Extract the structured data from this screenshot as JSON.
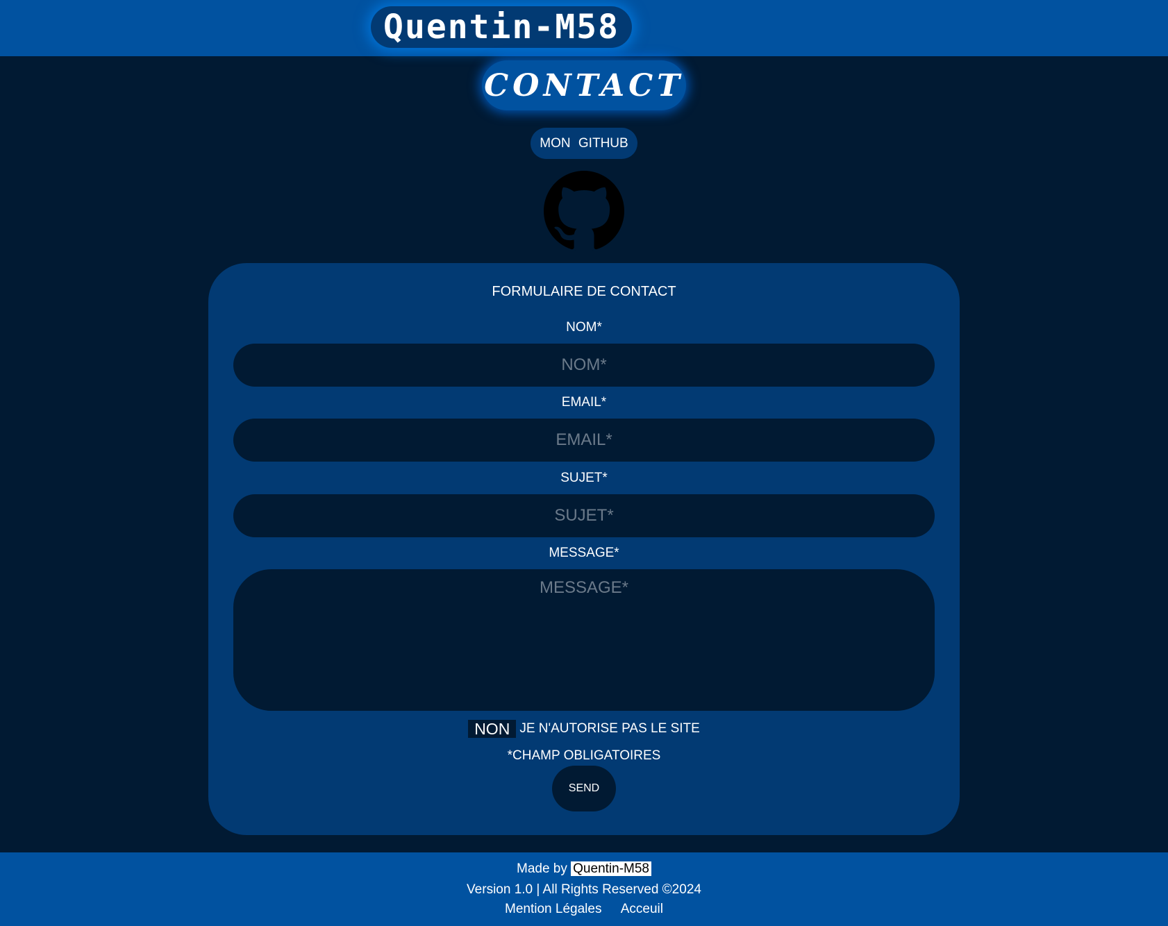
{
  "header": {
    "site_title": "Quentin-M58",
    "page_title": "CONTACT"
  },
  "github": {
    "label": "MON  GITHUB",
    "icon": "github-icon"
  },
  "form": {
    "heading": "FORMULAIRE DE CONTACT",
    "name_label": "NOM*",
    "name_placeholder": "NOM*",
    "name_value": "",
    "email_label": "EMAIL*",
    "email_placeholder": "EMAIL*",
    "email_value": "",
    "subject_label": "SUJET*",
    "subject_placeholder": "SUJET*",
    "subject_value": "",
    "message_label": "MESSAGE*",
    "message_placeholder": "MESSAGE*",
    "message_value": "",
    "consent_toggle": "NON",
    "consent_text": "JE N'AUTORISE PAS LE SITE",
    "required_note": "*CHAMP OBLIGATOIRES",
    "send_label": "SEND"
  },
  "footer": {
    "made_by_prefix": "Made by",
    "author": "Quentin-M58",
    "version_line": "Version 1.0 | All Rights Reserved ©2024",
    "links": [
      "Mention Légales",
      "Acceuil"
    ]
  },
  "colors": {
    "background": "#011a33",
    "bar": "#0152a0",
    "card": "#023a73"
  }
}
